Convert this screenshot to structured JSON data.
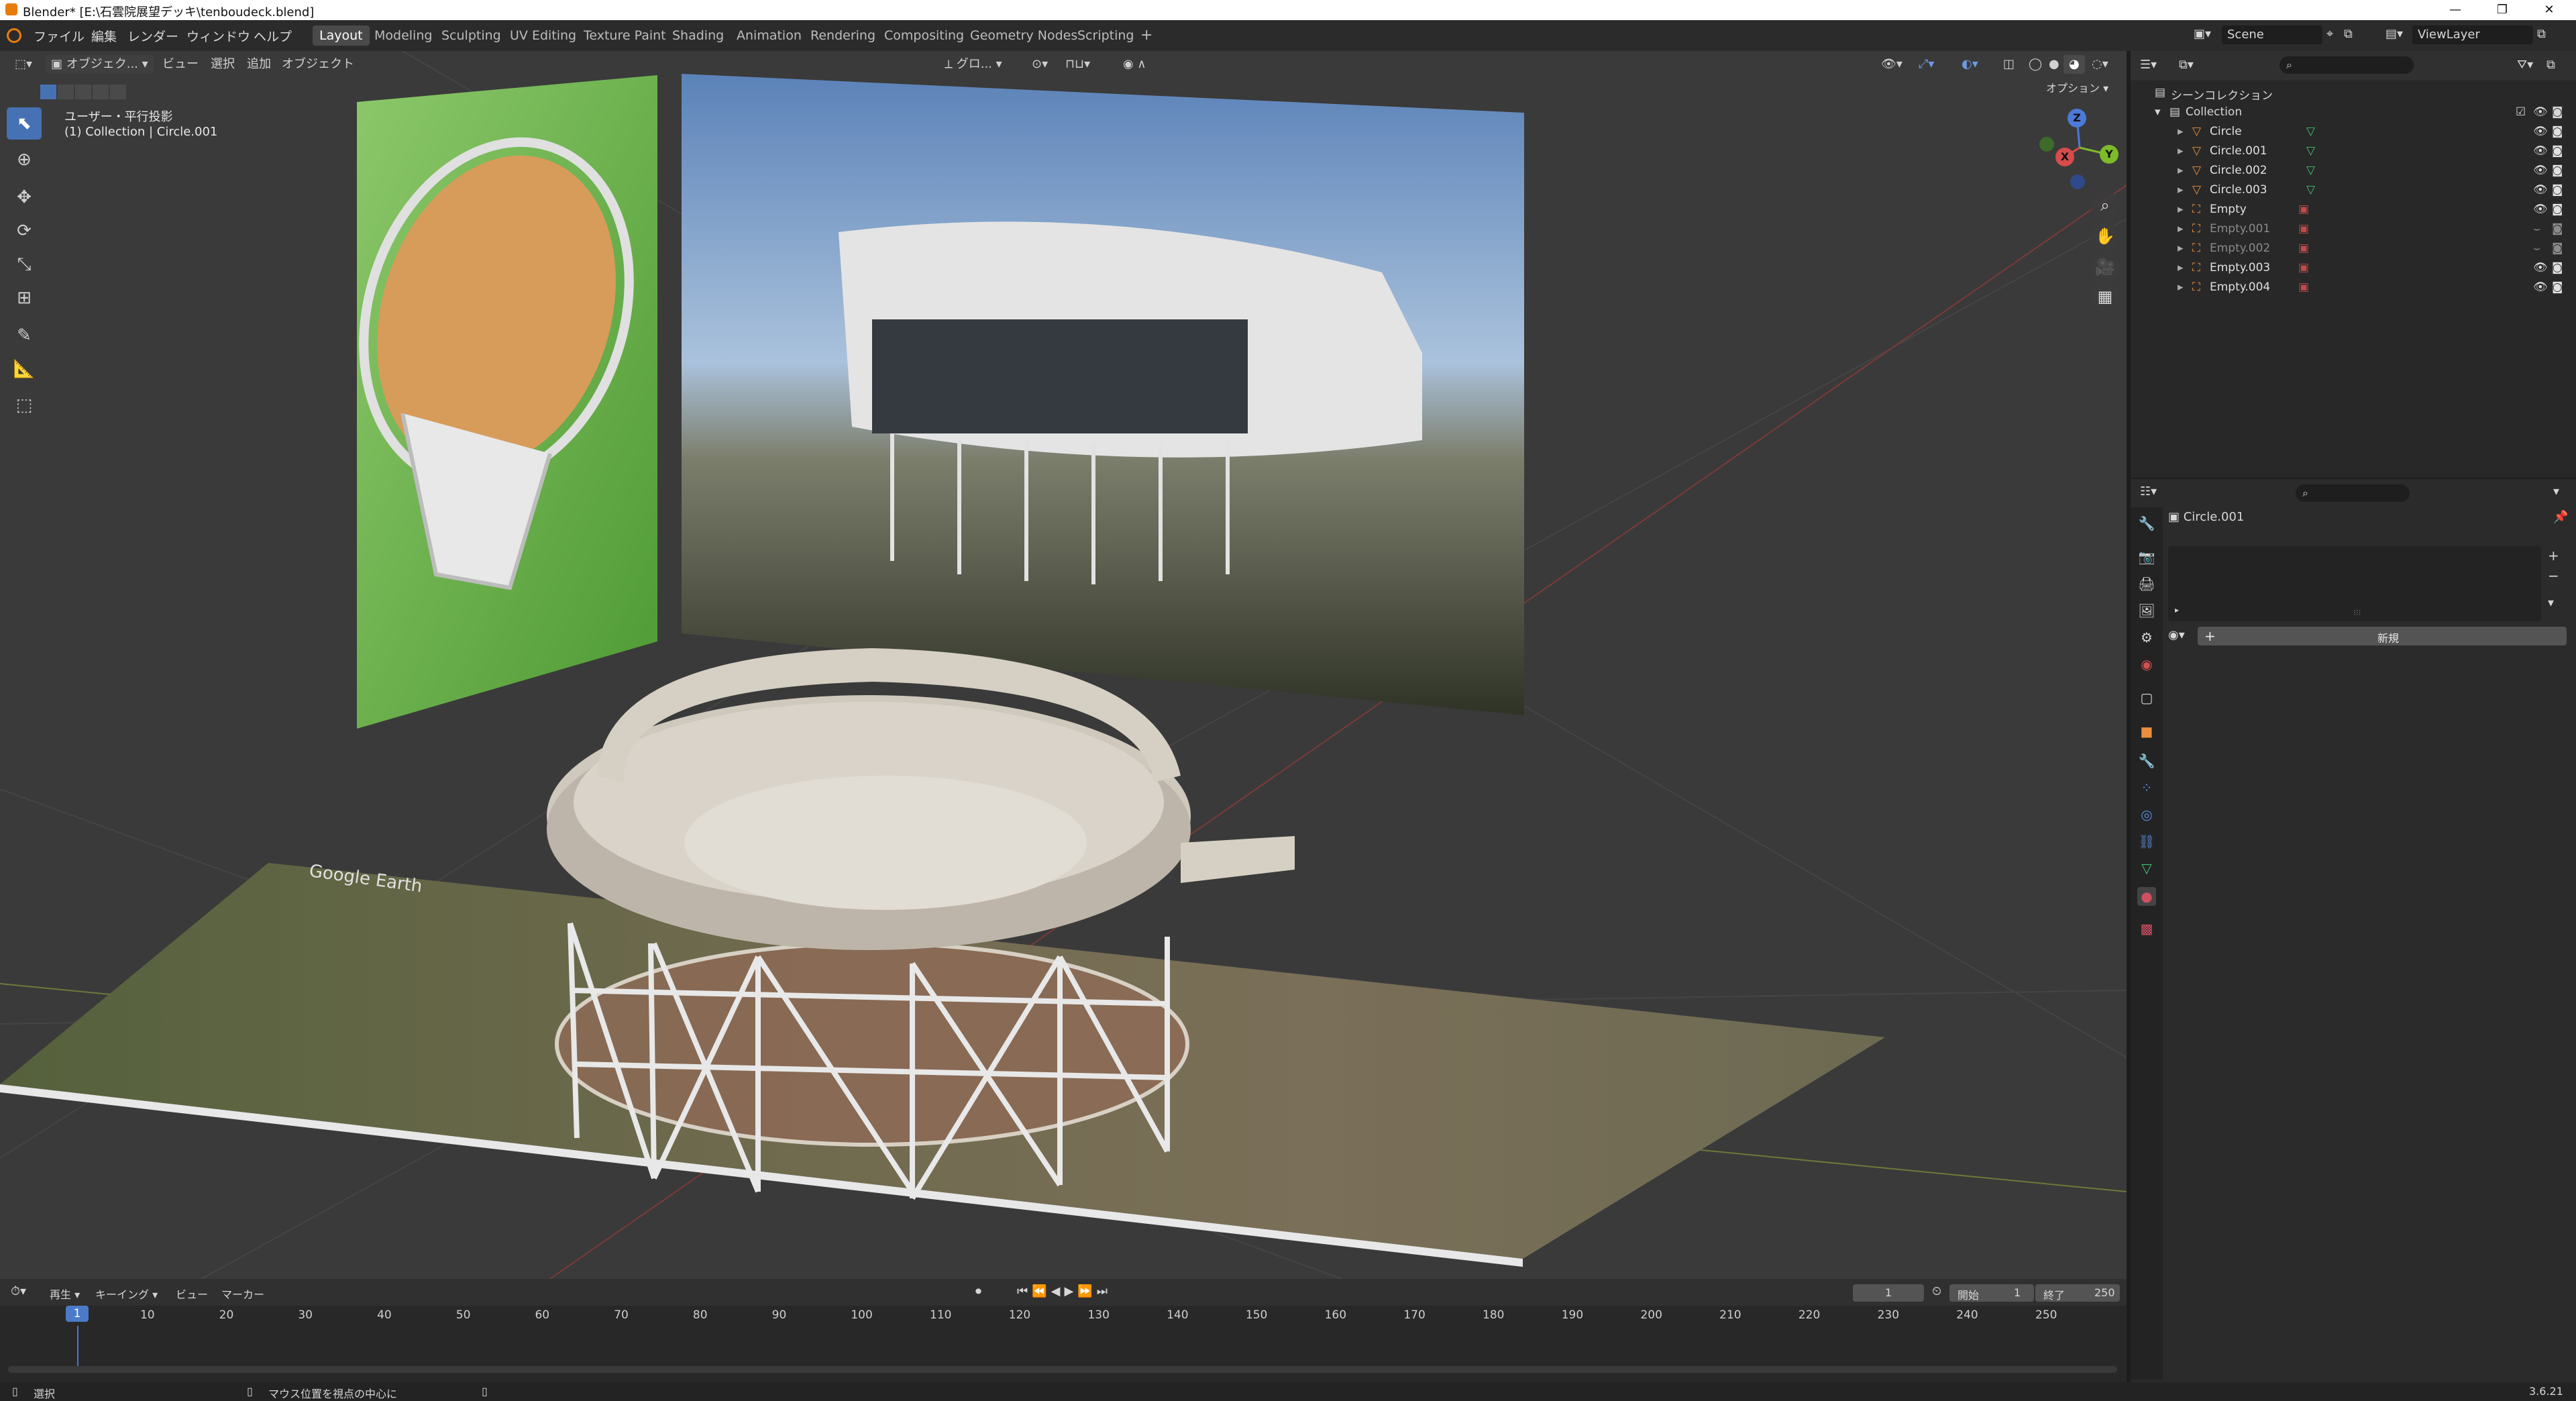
{
  "window": {
    "title": "Blender* [E:\\石雲院展望デッキ\\tenboudeck.blend]",
    "minimize_icon": "minimize-icon",
    "maximize_icon": "maximize-icon",
    "close_icon": "close-icon"
  },
  "menu": {
    "items": [
      "ファイル",
      "編集",
      "レンダー",
      "ウィンドウ",
      "ヘルプ"
    ]
  },
  "workspaces": [
    "Layout",
    "Modeling",
    "Sculpting",
    "UV Editing",
    "Texture Paint",
    "Shading",
    "Animation",
    "Rendering",
    "Compositing",
    "Geometry Nodes",
    "Scripting"
  ],
  "active_workspace": "Layout",
  "scene": {
    "scene_name": "Scene",
    "view_layer": "ViewLayer"
  },
  "viewport": {
    "mode": "オブジェク...",
    "menus": [
      "ビュー",
      "選択",
      "追加",
      "オブジェクト"
    ],
    "transform_orientation": "グロ...",
    "options_label": "オプション",
    "view_label": "ユーザー・平行投影",
    "context_label": "(1) Collection | Circle.001",
    "gizmo": {
      "x": "X",
      "y": "Y",
      "z": "Z"
    },
    "watermark": "Google Earth"
  },
  "outliner": {
    "root": "シーンコレクション",
    "collection": "Collection",
    "items": [
      {
        "name": "Circle",
        "dim": false
      },
      {
        "name": "Circle.001",
        "dim": false
      },
      {
        "name": "Circle.002",
        "dim": false
      },
      {
        "name": "Circle.003",
        "dim": false
      },
      {
        "name": "Empty",
        "dim": false
      },
      {
        "name": "Empty.001",
        "dim": true
      },
      {
        "name": "Empty.002",
        "dim": true
      },
      {
        "name": "Empty.003",
        "dim": false
      },
      {
        "name": "Empty.004",
        "dim": false
      }
    ]
  },
  "properties": {
    "object_name": "Circle.001",
    "new_button": "新規"
  },
  "timeline": {
    "menus": [
      "再生",
      "キーイング",
      "ビュー",
      "マーカー"
    ],
    "current_frame": "1",
    "start_label": "開始",
    "start_value": "1",
    "end_label": "終了",
    "end_value": "250",
    "ticks": [
      "1",
      "10",
      "20",
      "30",
      "40",
      "50",
      "60",
      "70",
      "80",
      "90",
      "100",
      "110",
      "120",
      "130",
      "140",
      "150",
      "160",
      "170",
      "180",
      "190",
      "200",
      "210",
      "220",
      "230",
      "240",
      "250"
    ]
  },
  "status": {
    "left": "選択",
    "middle": "マウス位置を視点の中心に",
    "version": "3.6.21"
  }
}
